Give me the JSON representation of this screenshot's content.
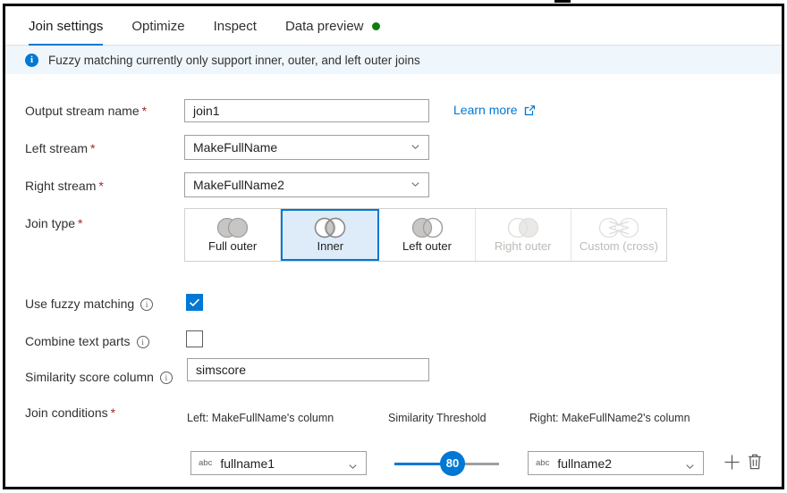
{
  "tabs": [
    {
      "label": "Join settings",
      "active": true,
      "dot": false
    },
    {
      "label": "Optimize",
      "active": false,
      "dot": false
    },
    {
      "label": "Inspect",
      "active": false,
      "dot": false
    },
    {
      "label": "Data preview",
      "active": false,
      "dot": true
    }
  ],
  "info_bar": {
    "icon": "info-circle-icon",
    "message": "Fuzzy matching currently only support inner, outer, and left outer joins"
  },
  "fields": {
    "output_stream": {
      "label": "Output stream name",
      "required": "*",
      "value": "join1"
    },
    "left_stream": {
      "label": "Left stream",
      "required": "*",
      "value": "MakeFullName"
    },
    "right_stream": {
      "label": "Right stream",
      "required": "*",
      "value": "MakeFullName2"
    },
    "join_type": {
      "label": "Join type",
      "required": "*"
    },
    "use_fuzzy_matching": {
      "label": "Use fuzzy matching",
      "checked": true
    },
    "combine_text_parts": {
      "label": "Combine text parts",
      "checked": false
    },
    "similarity_score_column": {
      "label": "Similarity score column",
      "value": "simscore"
    },
    "join_conditions": {
      "label": "Join conditions",
      "required": "*"
    }
  },
  "learn_more": {
    "label": "Learn more",
    "icon": "external-link-icon"
  },
  "join_types": [
    {
      "label": "Full outer",
      "icon": "venn-full-outer-icon",
      "selected": false,
      "disabled": false
    },
    {
      "label": "Inner",
      "icon": "venn-inner-icon",
      "selected": true,
      "disabled": false
    },
    {
      "label": "Left outer",
      "icon": "venn-left-outer-icon",
      "selected": false,
      "disabled": false
    },
    {
      "label": "Right outer",
      "icon": "venn-right-outer-icon",
      "selected": false,
      "disabled": true
    },
    {
      "label": "Custom (cross)",
      "icon": "venn-cross-icon",
      "selected": false,
      "disabled": true
    }
  ],
  "condition_headers": {
    "left": "Left: MakeFullName's column",
    "threshold": "Similarity Threshold",
    "right": "Right: MakeFullName2's column"
  },
  "condition_row": {
    "left_type_icon": "abc",
    "left_column": "fullname1",
    "threshold_value": "80",
    "threshold_min": 0,
    "threshold_max": 100,
    "right_type_icon": "abc",
    "right_column": "fullname2",
    "add_icon": "plus-icon",
    "delete_icon": "trash-icon"
  },
  "colors": {
    "accent": "#0078d4",
    "selected_fill": "#deecf9",
    "info_bar_bg": "#eff6fc",
    "required_red": "#a4262c",
    "status_green": "#107c10",
    "border": "#a19f9d"
  }
}
